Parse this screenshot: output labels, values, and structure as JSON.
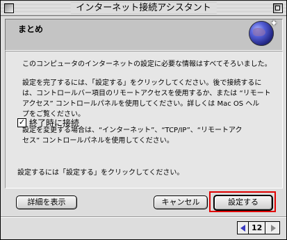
{
  "window": {
    "title": "インターネット接続アシスタント"
  },
  "header": {
    "title": "まとめ",
    "icon": "globe-icon"
  },
  "content": {
    "paragraph1": "このコンピュータのインターネットの設定に必要な情報はすべてそろいました。",
    "paragraph2_line1": "設定を完了するには、「設定する」をクリックしてください。後で接続するに",
    "paragraph2_line2": "は、コントロールバー項目のリモートアクセスを使用するか、または “リモート",
    "paragraph2_line3": "アクセス” コントロールパネルを使用してください。詳しくは Mac OS ヘル",
    "paragraph2_line4": "プをご覧ください。",
    "paragraph3_line1": "設定を変更する場合は、“インターネット”、“TCP/IP”、“リモートアク",
    "paragraph3_line2": "セス” コントロールパネルを使用してください。",
    "checkbox_label": "終了時に接続",
    "checkbox_checked": true,
    "checkbox_mark": "✓",
    "hint": "設定するには「設定する」をクリックしてください。"
  },
  "buttons": {
    "details": "詳細を表示",
    "cancel": "キャンセル",
    "setup": "設定する"
  },
  "pager": {
    "page": "12"
  },
  "colors": {
    "highlight_ring": "#e00000",
    "arrow_active": "#3a3ac0"
  }
}
